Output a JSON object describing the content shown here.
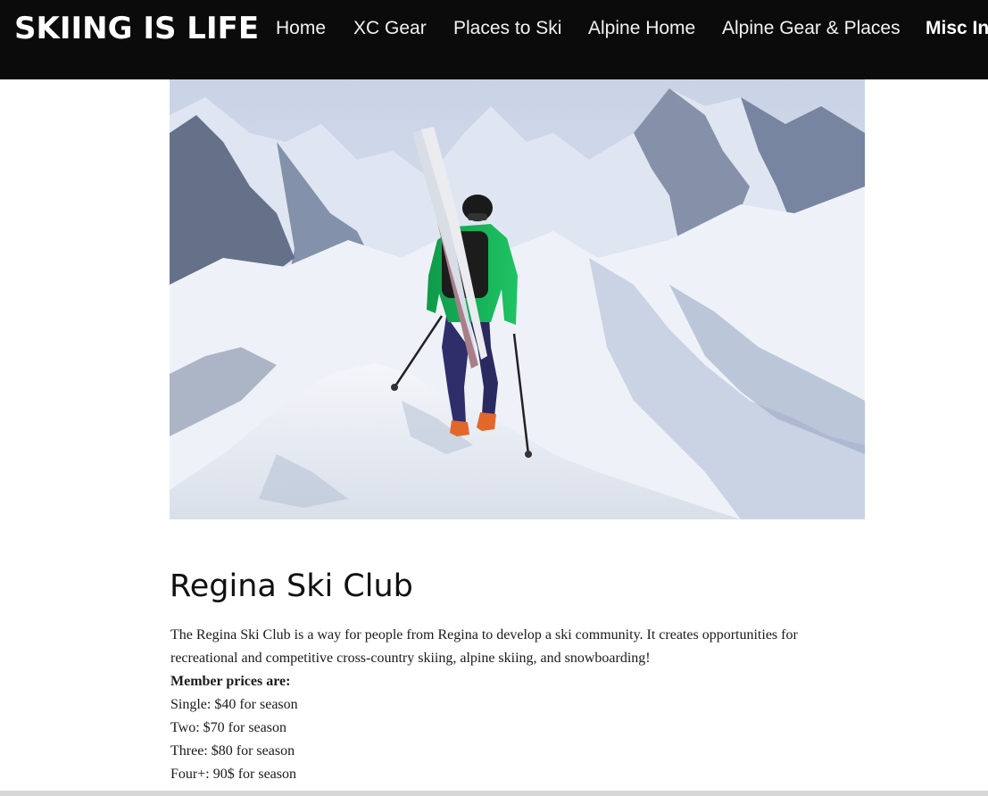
{
  "header": {
    "logo_text": "SKIING IS LIFE",
    "background_color": "#0b0b0b",
    "nav": [
      {
        "label": "Home",
        "active": false
      },
      {
        "label": "XC Gear",
        "active": false
      },
      {
        "label": "Places to Ski",
        "active": false
      },
      {
        "label": "Alpine Home",
        "active": false
      },
      {
        "label": "Alpine Gear & Places",
        "active": false
      },
      {
        "label": "Misc In",
        "active": true
      }
    ]
  },
  "hero": {
    "icon": "skier-on-mountain-ridge-photo"
  },
  "main": {
    "title": "Regina Ski Club",
    "intro": "The Regina Ski Club is a way for people from Regina to develop a ski community. It creates opportunities for recreational and competitive cross-country skiing, alpine skiing, and snowboarding!",
    "prices_label": "Member prices are:",
    "prices": [
      "Single: $40 for season",
      "Two: $70 for season",
      "Three: $80 for season",
      "Four+: 90$ for season"
    ]
  }
}
